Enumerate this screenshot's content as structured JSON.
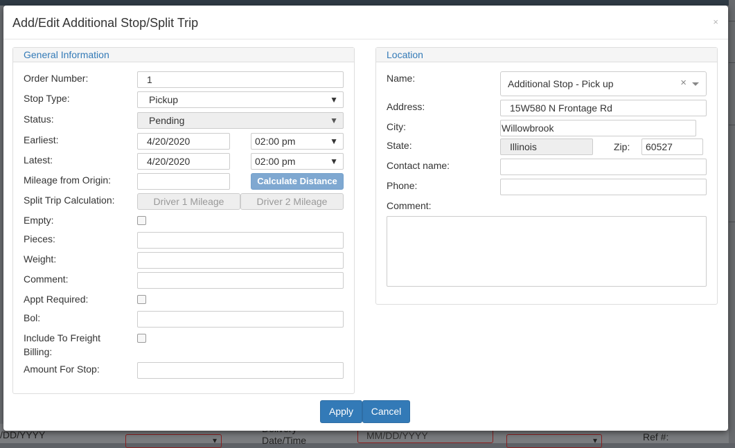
{
  "background": {
    "left_text": "/DD/YYYY",
    "delivery_label": "Delivery",
    "datetime_label": "Date/Time",
    "date_placeholder": "MM/DD/YYYY",
    "ref_label": "Ref #:"
  },
  "modal": {
    "title": "Add/Edit Additional Stop/Split Trip",
    "close_label": "×"
  },
  "general": {
    "heading": "General Information",
    "order_number_label": "Order Number:",
    "order_number_value": "1",
    "stop_type_label": "Stop Type:",
    "stop_type_value": "Pickup",
    "status_label": "Status:",
    "status_value": "Pending",
    "earliest_label": "Earliest:",
    "earliest_date": "4/20/2020",
    "earliest_time": "02:00 pm",
    "latest_label": "Latest:",
    "latest_date": "4/20/2020",
    "latest_time": "02:00 pm",
    "mileage_label": "Mileage from Origin:",
    "mileage_value": "",
    "calculate_label": "Calculate Distance",
    "split_label": "Split Trip Calculation:",
    "driver1_label": "Driver 1 Mileage",
    "driver2_label": "Driver 2 Mileage",
    "empty_label": "Empty:",
    "empty_checked": false,
    "pieces_label": "Pieces:",
    "weight_label": "Weight:",
    "comment_label": "Comment:",
    "appt_label": "Appt Required:",
    "appt_checked": false,
    "bol_label": "Bol:",
    "include_label_line1": "Include To Freight",
    "include_label_line2": "Billing:",
    "include_checked": false,
    "amount_label": "Amount For Stop:"
  },
  "location": {
    "heading": "Location",
    "name_label": "Name:",
    "name_value": "Additional Stop - Pick up",
    "address_label": "Address:",
    "address_value": "15W580 N Frontage Rd",
    "city_label": "City:",
    "city_value": "Willowbrook",
    "state_label": "State:",
    "state_value": "Illinois",
    "zip_label": "Zip:",
    "zip_value": "60527",
    "contact_label": "Contact name:",
    "phone_label": "Phone:",
    "comment_label": "Comment:"
  },
  "footer": {
    "apply_label": "Apply",
    "cancel_label": "Cancel"
  },
  "colors": {
    "accent": "#337ab7",
    "calc_button": "#7fa8d1"
  }
}
